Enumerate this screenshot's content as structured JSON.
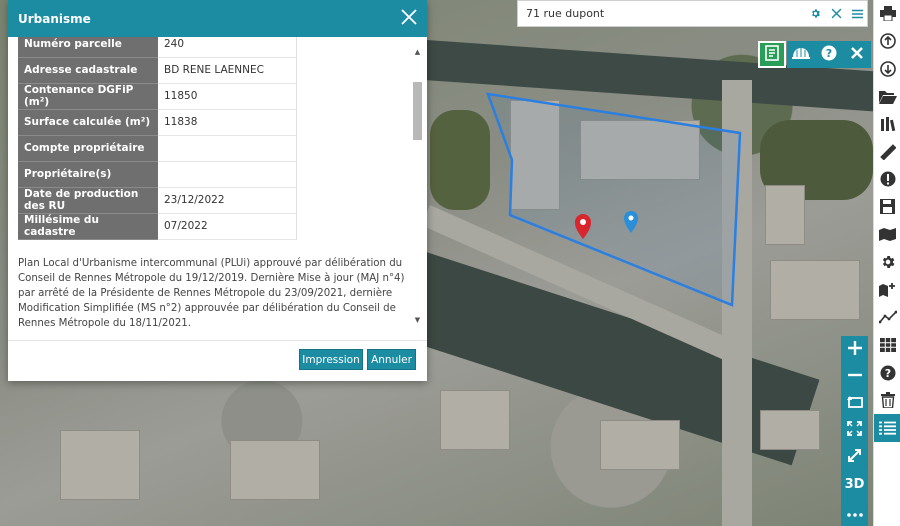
{
  "dialog": {
    "title": "Urbanisme",
    "rows": [
      {
        "label": "Numéro parcelle",
        "value": "240"
      },
      {
        "label": "Adresse cadastrale",
        "value": "BD RENE LAENNEC"
      },
      {
        "label": "Contenance DGFiP (m²)",
        "value": "11850"
      },
      {
        "label": "Surface calculée (m²)",
        "value": "11838"
      },
      {
        "label": "Compte propriétaire",
        "value": ""
      },
      {
        "label": "Propriétaire(s)",
        "value": ""
      },
      {
        "label": "Date de production des RU",
        "value": "23/12/2022"
      },
      {
        "label": "Millésime du cadastre",
        "value": "07/2022"
      }
    ],
    "plu_text": "Plan Local d'Urbanisme intercommunal (PLUi) approuvé par délibération du Conseil de Rennes Métropole du 19/12/2019. Dernière Mise à jour (MAJ n°4) par arrêté de la Présidente de Rennes Métropole du 23/09/2021, dernière Modification Simplifiée (MS n°2) approuvée par délibération du Conseil de Rennes Métropole du 18/11/2021.",
    "print_label": "Impression",
    "cancel_label": "Annuler"
  },
  "search": {
    "value": "71 rue dupont"
  },
  "zoom": {
    "label_3d": "3D"
  },
  "colors": {
    "accent": "#1c8ca3",
    "parcel_outline": "#2a7fe0",
    "marker_red": "#d7262e",
    "marker_blue": "#2a8fd8",
    "doc_button": "#2a9e58"
  },
  "icons": {
    "right_bar": [
      "print-icon",
      "arrow-up-circle-icon",
      "arrow-down-circle-icon",
      "folder-open-icon",
      "library-icon",
      "ruler-icon",
      "alert-icon",
      "save-icon",
      "map-icon",
      "gear-icon",
      "map-add-icon",
      "chart-line-icon",
      "table-icon",
      "help-icon",
      "trash-icon",
      "list-icon"
    ],
    "map_actions": [
      "document-icon",
      "layers-icon",
      "help-icon",
      "close-icon"
    ],
    "zoom": [
      "zoom-in-icon",
      "zoom-out-icon",
      "rotate-icon",
      "fullscreen-icon",
      "expand-icon",
      "3d-button",
      "more-icon"
    ]
  }
}
